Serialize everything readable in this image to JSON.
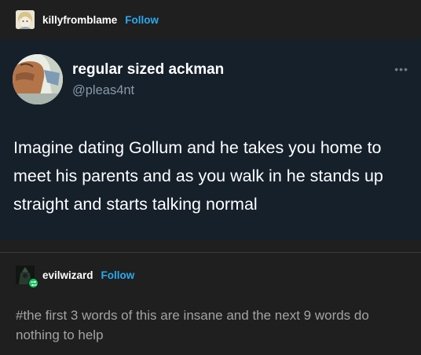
{
  "header": {
    "username": "killyfromblame",
    "follow_label": "Follow",
    "avatar_icon": "anime-avatar-icon"
  },
  "tweet": {
    "display_name": "regular sized ackman",
    "handle": "@pleas4nt",
    "more_icon": "ellipsis-icon",
    "more_glyph": "•••",
    "text": "Imagine dating Gollum and he takes you home to meet his parents and as you walk in he stands up straight and starts talking normal",
    "avatar_icon": "horse-avatar-icon",
    "background_color": "#15202b"
  },
  "reblog": {
    "username": "evilwizard",
    "follow_label": "Follow",
    "avatar_icon": "dark-avatar-icon",
    "badge_icon": "reblog-icon",
    "badge_color": "#12c45a"
  },
  "tags": {
    "text": "#the first 3 words of this are insane and the next 9 words do nothing to help"
  },
  "colors": {
    "page_bg": "#1f1f1f",
    "follow": "#2aa9f0",
    "tag_text": "#a3a3a3",
    "handle": "#8899a6"
  }
}
